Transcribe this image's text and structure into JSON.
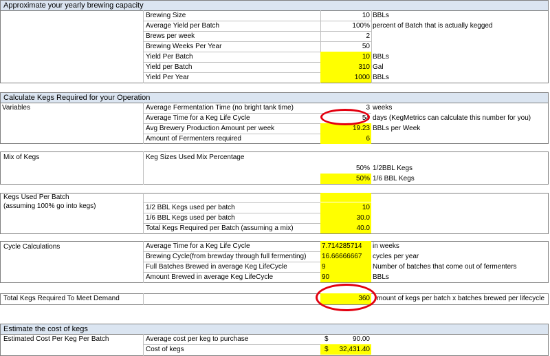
{
  "sections": {
    "s1": "Approximate your yearly brewing capacity",
    "s2": "Calculate Kegs Required for your Operation",
    "s3": "Estimate the cost of kegs"
  },
  "capacity": [
    {
      "label": "Brewing Size",
      "value": "10",
      "unit": "BBLs",
      "hl": false
    },
    {
      "label": "Average Yield per Batch",
      "value": "100%",
      "unit": "percent of Batch that is actually kegged",
      "hl": false
    },
    {
      "label": "Brews per week",
      "value": "2",
      "unit": "",
      "hl": false
    },
    {
      "label": "Brewing Weeks Per Year",
      "value": "50",
      "unit": "",
      "hl": false
    },
    {
      "label": "Yield Per Batch",
      "value": "10",
      "unit": "BBLs",
      "hl": true
    },
    {
      "label": "Yield per Batch",
      "value": "310",
      "unit": "Gal",
      "hl": true
    },
    {
      "label": "Yield Per Year",
      "value": "1000",
      "unit": "BBLs",
      "hl": true
    }
  ],
  "variables": {
    "title": "Variables",
    "rows": [
      {
        "label": "Average Fermentation Time (no bright tank time)",
        "value": "3",
        "unit": "weeks",
        "hl": false
      },
      {
        "label": "Average Time for a Keg Life Cycle",
        "value": "54",
        "unit": "days (KegMetrics can calculate this number for you)",
        "hl": false
      },
      {
        "label": "Avg Brewery Production Amount per week",
        "value": "19.23",
        "unit": "BBLs per Week",
        "hl": true
      },
      {
        "label": "Amount of Fermenters required",
        "value": "6",
        "unit": "",
        "hl": true
      }
    ]
  },
  "mix": {
    "title": "Mix of Kegs",
    "header": "Keg Sizes Used Mix Percentage",
    "rows": [
      {
        "value": "50%",
        "unit": "1/2BBL Kegs",
        "hl": false
      },
      {
        "value": "50%",
        "unit": "1/6 BBL Kegs",
        "hl": true
      }
    ]
  },
  "kegs_batch": {
    "title": "Kegs Used Per Batch",
    "subtitle": "(assuming 100% go into kegs)",
    "rows": [
      {
        "label": "1/2 BBL Kegs used per batch",
        "value": "10"
      },
      {
        "label": "1/6 BBL Kegs used per batch",
        "value": "30.0"
      },
      {
        "label": "Total Kegs Required per Batch (assuming a mix)",
        "value": "40.0"
      }
    ]
  },
  "cycle": {
    "title": "Cycle Calculations",
    "rows": [
      {
        "label": "Average Time for a Keg Life Cycle",
        "value": "7.714285714",
        "unit": "in weeks"
      },
      {
        "label": "Brewing Cycle(from brewday through full fermenting)",
        "value": "16.66666667",
        "unit": "cycles per year"
      },
      {
        "label": "Full Batches Brewed in average Keg LifeCycle",
        "value": "9",
        "unit": "Number of batches that come out of fermenters"
      },
      {
        "label": "Amount Brewed in average Keg LifeCycle",
        "value": "90",
        "unit": "BBLs"
      }
    ]
  },
  "total": {
    "label": "Total Kegs Required To Meet Demand",
    "value": "360",
    "unit": "mount of kegs per batch x batches brewed per lifecycle"
  },
  "cost": {
    "title": "Estimated Cost Per Keg Per Batch",
    "rows": [
      {
        "label": "Average cost per keg to purchase",
        "currency": "$",
        "value": "90.00",
        "hl": false
      },
      {
        "label": "Cost of kegs",
        "currency": "$",
        "value": "32,431.40",
        "hl": true
      }
    ]
  },
  "colors": {
    "highlight": "#ffff00",
    "section_header": "#dbe5f1",
    "annotation": "#e3000f"
  }
}
